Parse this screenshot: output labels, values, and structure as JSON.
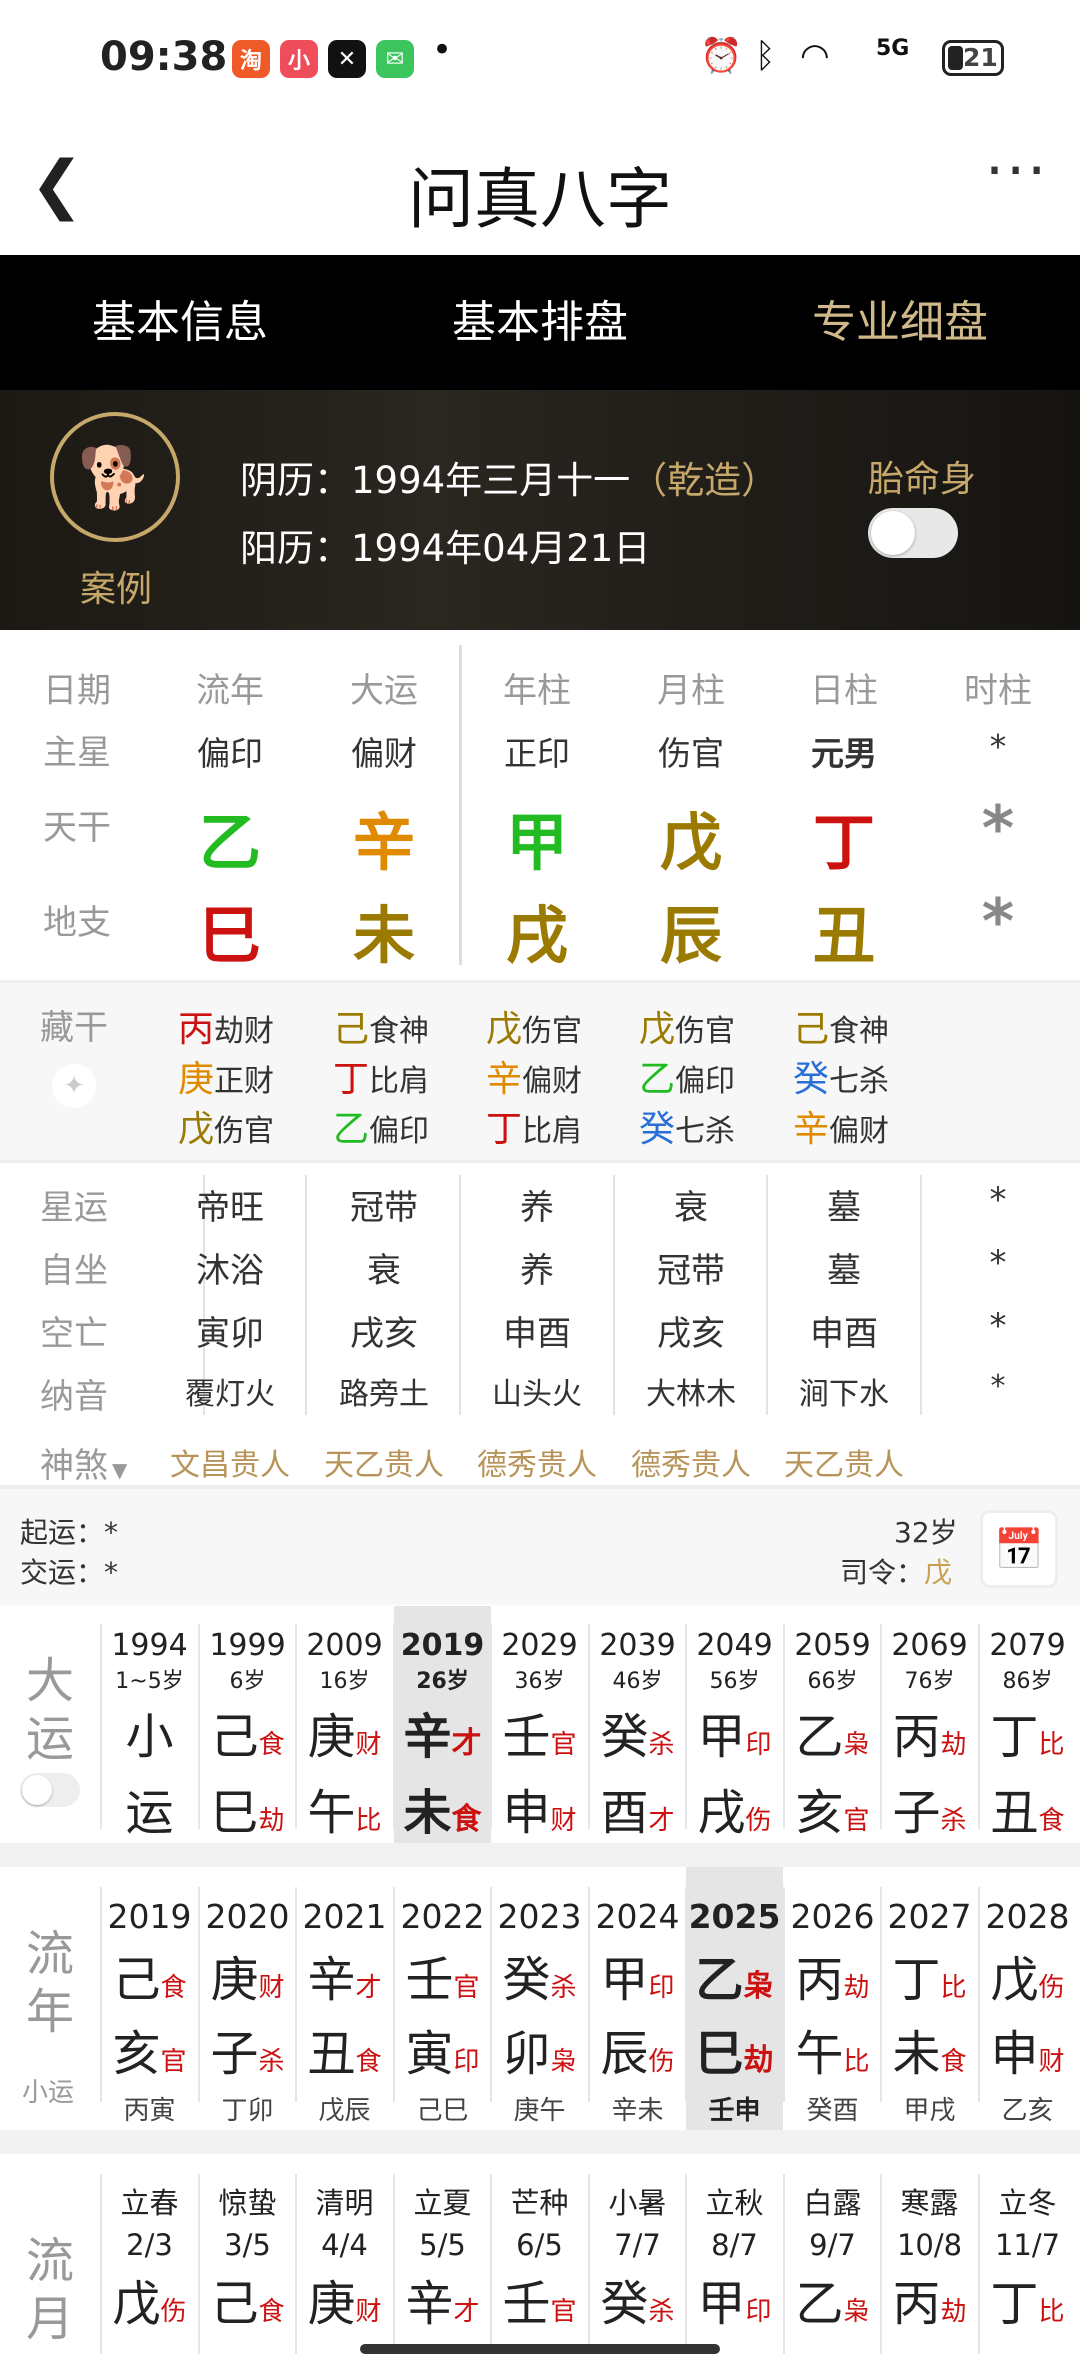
{
  "status": {
    "time": "09:38",
    "apps": [
      "淘",
      "小",
      "✕",
      "✉"
    ],
    "battery": "21",
    "network": "5G"
  },
  "titlebar": {
    "title": "问真八字"
  },
  "tabs": [
    {
      "label": "基本信息"
    },
    {
      "label": "基本排盘"
    },
    {
      "label": "专业细盘",
      "active": true
    }
  ],
  "profile": {
    "avatar_label": "案例",
    "lunar_prefix": "阴历：",
    "lunar": "1994年三月十一",
    "qianzao": "（乾造）",
    "solar_prefix": "阳历：",
    "solar": "1994年04月21日",
    "taimingshen": "胎命身"
  },
  "pillars": {
    "headers": [
      "日期",
      "流年",
      "大运",
      "年柱",
      "月柱",
      "日柱",
      "时柱"
    ],
    "zhuxing_label": "主星",
    "zhuxing": [
      "偏印",
      "偏财",
      "正印",
      "伤官",
      "元男",
      "*"
    ],
    "tiangan_label": "天干",
    "tiangan": [
      {
        "c": "乙",
        "color": "#22bb22"
      },
      {
        "c": "辛",
        "color": "#e08a00"
      },
      {
        "c": "甲",
        "color": "#22bb22"
      },
      {
        "c": "戊",
        "color": "#9a7a00"
      },
      {
        "c": "丁",
        "color": "#cc1111"
      },
      {
        "c": "*",
        "color": "#888888"
      }
    ],
    "dizhi_label": "地支",
    "dizhi": [
      {
        "c": "巳",
        "color": "#cc1111"
      },
      {
        "c": "未",
        "color": "#9a7a00"
      },
      {
        "c": "戌",
        "color": "#9a7a00"
      },
      {
        "c": "辰",
        "color": "#9a7a00"
      },
      {
        "c": "丑",
        "color": "#9a7a00"
      },
      {
        "c": "*",
        "color": "#888888"
      }
    ]
  },
  "canggan": {
    "label": "藏干",
    "cols": [
      [
        {
          "c": "丙",
          "color": "#cc1111",
          "t": "劫财"
        },
        {
          "c": "庚",
          "color": "#e08a00",
          "t": "正财"
        },
        {
          "c": "戊",
          "color": "#9a7a00",
          "t": "伤官"
        }
      ],
      [
        {
          "c": "己",
          "color": "#9a7a00",
          "t": "食神"
        },
        {
          "c": "丁",
          "color": "#cc1111",
          "t": "比肩"
        },
        {
          "c": "乙",
          "color": "#22bb22",
          "t": "偏印"
        }
      ],
      [
        {
          "c": "戊",
          "color": "#9a7a00",
          "t": "伤官"
        },
        {
          "c": "辛",
          "color": "#e08a00",
          "t": "偏财"
        },
        {
          "c": "丁",
          "color": "#cc1111",
          "t": "比肩"
        }
      ],
      [
        {
          "c": "戊",
          "color": "#9a7a00",
          "t": "伤官"
        },
        {
          "c": "乙",
          "color": "#22bb22",
          "t": "偏印"
        },
        {
          "c": "癸",
          "color": "#2a6fd6",
          "t": "七杀"
        }
      ],
      [
        {
          "c": "己",
          "color": "#9a7a00",
          "t": "食神"
        },
        {
          "c": "癸",
          "color": "#2a6fd6",
          "t": "七杀"
        },
        {
          "c": "辛",
          "color": "#e08a00",
          "t": "偏财"
        }
      ]
    ]
  },
  "stars": {
    "rows": [
      {
        "label": "星运",
        "values": [
          "帝旺",
          "冠带",
          "养",
          "衰",
          "墓",
          "*"
        ]
      },
      {
        "label": "自坐",
        "values": [
          "沐浴",
          "衰",
          "养",
          "冠带",
          "墓",
          "*"
        ]
      },
      {
        "label": "空亡",
        "values": [
          "寅卯",
          "戌亥",
          "申酉",
          "戌亥",
          "申酉",
          "*"
        ]
      },
      {
        "label": "纳音",
        "values": [
          "覆灯火",
          "路旁土",
          "山头火",
          "大林木",
          "涧下水",
          "*"
        ]
      }
    ],
    "shensha_label": "神煞",
    "shensha": [
      "文昌贵人",
      "天乙贵人",
      "德秀贵人",
      "德秀贵人",
      "天乙贵人"
    ]
  },
  "qiyun": {
    "qiyun_label": "起运：",
    "qiyun_val": "*",
    "jiaoyun_label": "交运：",
    "jiaoyun_val": "*",
    "age": "32岁",
    "siling_label": "司令：",
    "siling_val": "戊"
  },
  "dayun": {
    "label": "大运",
    "items": [
      {
        "yr": "1994",
        "age": "1~5岁",
        "t": "小",
        "ts": "",
        "d": "运",
        "ds": ""
      },
      {
        "yr": "1999",
        "age": "6岁",
        "t": "己",
        "ts": "食",
        "d": "巳",
        "ds": "劫"
      },
      {
        "yr": "2009",
        "age": "16岁",
        "t": "庚",
        "ts": "财",
        "d": "午",
        "ds": "比"
      },
      {
        "yr": "2019",
        "age": "26岁",
        "t": "辛",
        "ts": "才",
        "d": "未",
        "ds": "食",
        "sel": true
      },
      {
        "yr": "2029",
        "age": "36岁",
        "t": "壬",
        "ts": "官",
        "d": "申",
        "ds": "财"
      },
      {
        "yr": "2039",
        "age": "46岁",
        "t": "癸",
        "ts": "杀",
        "d": "酉",
        "ds": "才"
      },
      {
        "yr": "2049",
        "age": "56岁",
        "t": "甲",
        "ts": "印",
        "d": "戌",
        "ds": "伤"
      },
      {
        "yr": "2059",
        "age": "66岁",
        "t": "乙",
        "ts": "枭",
        "d": "亥",
        "ds": "官"
      },
      {
        "yr": "2069",
        "age": "76岁",
        "t": "丙",
        "ts": "劫",
        "d": "子",
        "ds": "杀"
      },
      {
        "yr": "2079",
        "age": "86岁",
        "t": "丁",
        "ts": "比",
        "d": "丑",
        "ds": "食"
      }
    ]
  },
  "liunian": {
    "label": "流年",
    "sublabel": "小运",
    "items": [
      {
        "yr": "2019",
        "t": "己",
        "ts": "食",
        "d": "亥",
        "ds": "官",
        "xy": "丙寅"
      },
      {
        "yr": "2020",
        "t": "庚",
        "ts": "财",
        "d": "子",
        "ds": "杀",
        "xy": "丁卯"
      },
      {
        "yr": "2021",
        "t": "辛",
        "ts": "才",
        "d": "丑",
        "ds": "食",
        "xy": "戊辰"
      },
      {
        "yr": "2022",
        "t": "壬",
        "ts": "官",
        "d": "寅",
        "ds": "印",
        "xy": "己巳"
      },
      {
        "yr": "2023",
        "t": "癸",
        "ts": "杀",
        "d": "卯",
        "ds": "枭",
        "xy": "庚午"
      },
      {
        "yr": "2024",
        "t": "甲",
        "ts": "印",
        "d": "辰",
        "ds": "伤",
        "xy": "辛未"
      },
      {
        "yr": "2025",
        "t": "乙",
        "ts": "枭",
        "d": "巳",
        "ds": "劫",
        "xy": "壬申",
        "sel": true
      },
      {
        "yr": "2026",
        "t": "丙",
        "ts": "劫",
        "d": "午",
        "ds": "比",
        "xy": "癸酉"
      },
      {
        "yr": "2027",
        "t": "丁",
        "ts": "比",
        "d": "未",
        "ds": "食",
        "xy": "甲戌"
      },
      {
        "yr": "2028",
        "t": "戊",
        "ts": "伤",
        "d": "申",
        "ds": "财",
        "xy": "乙亥"
      }
    ]
  },
  "liuyue": {
    "label": "流月",
    "items": [
      {
        "jq": "立春",
        "date": "2/3",
        "t": "戊",
        "ts": "伤"
      },
      {
        "jq": "惊蛰",
        "date": "3/5",
        "t": "己",
        "ts": "食"
      },
      {
        "jq": "清明",
        "date": "4/4",
        "t": "庚",
        "ts": "财"
      },
      {
        "jq": "立夏",
        "date": "5/5",
        "t": "辛",
        "ts": "才"
      },
      {
        "jq": "芒种",
        "date": "6/5",
        "t": "壬",
        "ts": "官"
      },
      {
        "jq": "小暑",
        "date": "7/7",
        "t": "癸",
        "ts": "杀"
      },
      {
        "jq": "立秋",
        "date": "8/7",
        "t": "甲",
        "ts": "印"
      },
      {
        "jq": "白露",
        "date": "9/7",
        "t": "乙",
        "ts": "枭"
      },
      {
        "jq": "寒露",
        "date": "10/8",
        "t": "丙",
        "ts": "劫"
      },
      {
        "jq": "立冬",
        "date": "11/7",
        "t": "丁",
        "ts": "比"
      }
    ]
  }
}
